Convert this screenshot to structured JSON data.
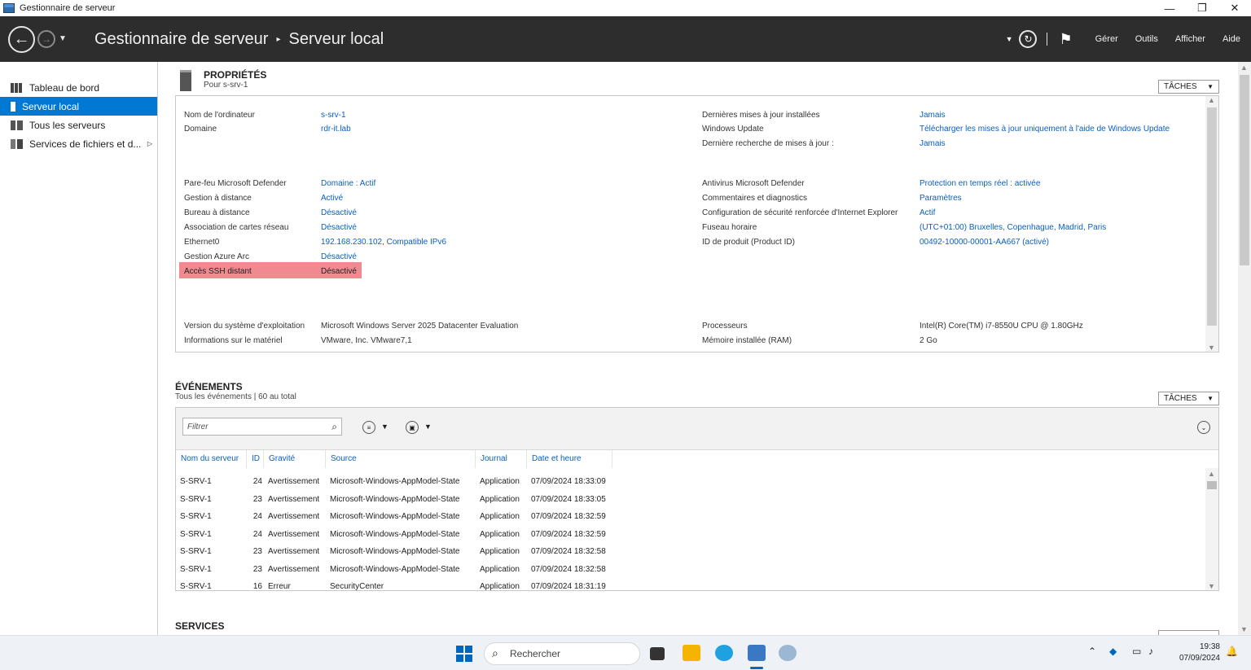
{
  "window": {
    "title": "Gestionnaire de serveur",
    "controls": {
      "minimize": "—",
      "maximize": "❐",
      "close": "✕"
    }
  },
  "header": {
    "breadcrumb_app": "Gestionnaire de serveur",
    "breadcrumb_sep": "▸",
    "breadcrumb_page": "Serveur local",
    "menus": [
      "Gérer",
      "Outils",
      "Afficher",
      "Aide"
    ]
  },
  "sidebar": {
    "items": [
      {
        "label": "Tableau de bord",
        "icon": "dashboard-icon"
      },
      {
        "label": "Serveur local",
        "icon": "server-icon",
        "active": true
      },
      {
        "label": "Tous les serveurs",
        "icon": "servers-icon"
      },
      {
        "label": "Services de fichiers et d...",
        "icon": "file-services-icon"
      }
    ]
  },
  "properties": {
    "title": "PROPRIÉTÉS",
    "subtitle": "Pour s-srv-1",
    "tasks_label": "TÂCHES",
    "left_group1": [
      {
        "label": "Nom de l'ordinateur",
        "value": "s-srv-1"
      },
      {
        "label": "Domaine",
        "value": "rdr-it.lab"
      }
    ],
    "left_group2": [
      {
        "label": "Pare-feu Microsoft Defender",
        "value": "Domaine : Actif"
      },
      {
        "label": "Gestion à distance",
        "value": "Activé"
      },
      {
        "label": "Bureau à distance",
        "value": "Désactivé"
      },
      {
        "label": "Association de cartes réseau",
        "value": "Désactivé"
      },
      {
        "label": "Ethernet0",
        "value": "192.168.230.102, Compatible IPv6"
      },
      {
        "label": "Gestion Azure Arc",
        "value": "Désactivé"
      },
      {
        "label": "Accès SSH distant",
        "value": "Désactivé"
      }
    ],
    "left_group3": [
      {
        "label": "Version du système d'exploitation",
        "value": "Microsoft Windows Server 2025 Datacenter Evaluation"
      },
      {
        "label": "Informations sur le matériel",
        "value": "VMware, Inc. VMware7,1"
      }
    ],
    "right_group1": [
      {
        "label": "Dernières mises à jour installées",
        "value": "Jamais"
      },
      {
        "label": "Windows Update",
        "value": "Télécharger les mises à jour uniquement à l'aide de Windows Update"
      },
      {
        "label": "Dernière recherche de mises à jour :",
        "value": "Jamais"
      }
    ],
    "right_group2": [
      {
        "label": "Antivirus Microsoft Defender",
        "value": "Protection en temps réel : activée"
      },
      {
        "label": "Commentaires et diagnostics",
        "value": "Paramètres"
      },
      {
        "label": "Configuration de sécurité renforcée d'Internet Explorer",
        "value": "Actif"
      },
      {
        "label": "Fuseau horaire",
        "value": "(UTC+01:00) Bruxelles, Copenhague, Madrid, Paris"
      },
      {
        "label": "ID de produit (Product ID)",
        "value": "00492-10000-00001-AA667 (activé)"
      }
    ],
    "right_group3": [
      {
        "label": "Processeurs",
        "value": "Intel(R) Core(TM) i7-8550U CPU @ 1.80GHz"
      },
      {
        "label": "Mémoire installée (RAM)",
        "value": "2 Go"
      }
    ],
    "highlight_color": "#f08a90"
  },
  "events": {
    "title": "ÉVÉNEMENTS",
    "subtitle": "Tous les événements | 60 au total",
    "tasks_label": "TÂCHES",
    "filter_placeholder": "Filtrer",
    "columns": [
      "Nom du serveur",
      "ID",
      "Gravité",
      "Source",
      "Journal",
      "Date et heure"
    ],
    "rows": [
      [
        "S-SRV-1",
        "24",
        "Avertissement",
        "Microsoft-Windows-AppModel-State",
        "Application",
        "07/09/2024 18:33:09"
      ],
      [
        "S-SRV-1",
        "23",
        "Avertissement",
        "Microsoft-Windows-AppModel-State",
        "Application",
        "07/09/2024 18:33:05"
      ],
      [
        "S-SRV-1",
        "24",
        "Avertissement",
        "Microsoft-Windows-AppModel-State",
        "Application",
        "07/09/2024 18:32:59"
      ],
      [
        "S-SRV-1",
        "24",
        "Avertissement",
        "Microsoft-Windows-AppModel-State",
        "Application",
        "07/09/2024 18:32:59"
      ],
      [
        "S-SRV-1",
        "23",
        "Avertissement",
        "Microsoft-Windows-AppModel-State",
        "Application",
        "07/09/2024 18:32:58"
      ],
      [
        "S-SRV-1",
        "23",
        "Avertissement",
        "Microsoft-Windows-AppModel-State",
        "Application",
        "07/09/2024 18:32:58"
      ],
      [
        "S-SRV-1",
        "16",
        "Erreur",
        "SecurityCenter",
        "Application",
        "07/09/2024 18:31:19"
      ]
    ]
  },
  "services": {
    "title": "SERVICES"
  },
  "taskbar": {
    "search_label": "Rechercher",
    "time": "19:38",
    "date": "07/09/2024"
  }
}
